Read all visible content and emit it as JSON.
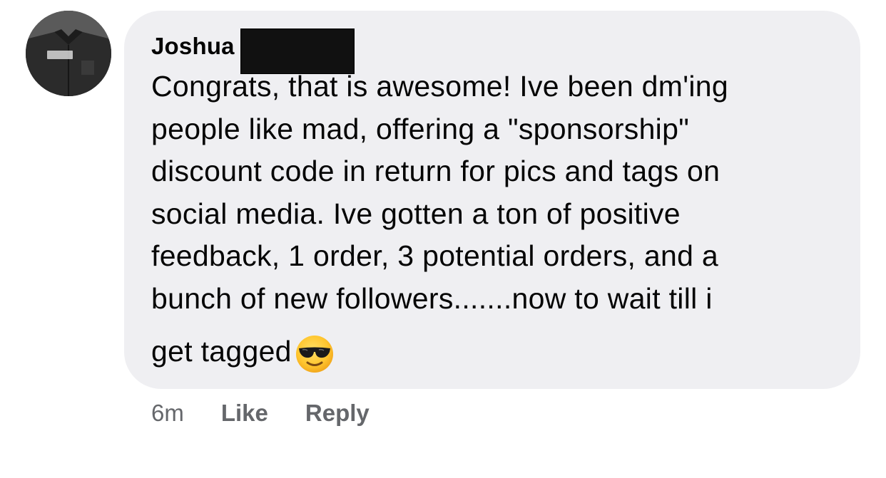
{
  "author": {
    "name": "Joshua",
    "surname_redacted": true
  },
  "comment": {
    "lines": [
      "Congrats, that is awesome!  Ive been dm'ing",
      "people like mad, offering a \"sponsorship\"",
      "discount code in return for pics and tags on",
      "social media. Ive gotten a ton of positive",
      "feedback, 1 order, 3 potential orders, and a",
      "bunch of new followers.......now to wait till i",
      "get tagged"
    ],
    "trailing_emoji": "smiling-face-with-sunglasses"
  },
  "meta": {
    "time": "6m",
    "like_label": "Like",
    "reply_label": "Reply"
  },
  "colors": {
    "bubble": "#efeff2",
    "text": "#050505",
    "meta_text": "#65676b",
    "redaction": "#111111"
  }
}
